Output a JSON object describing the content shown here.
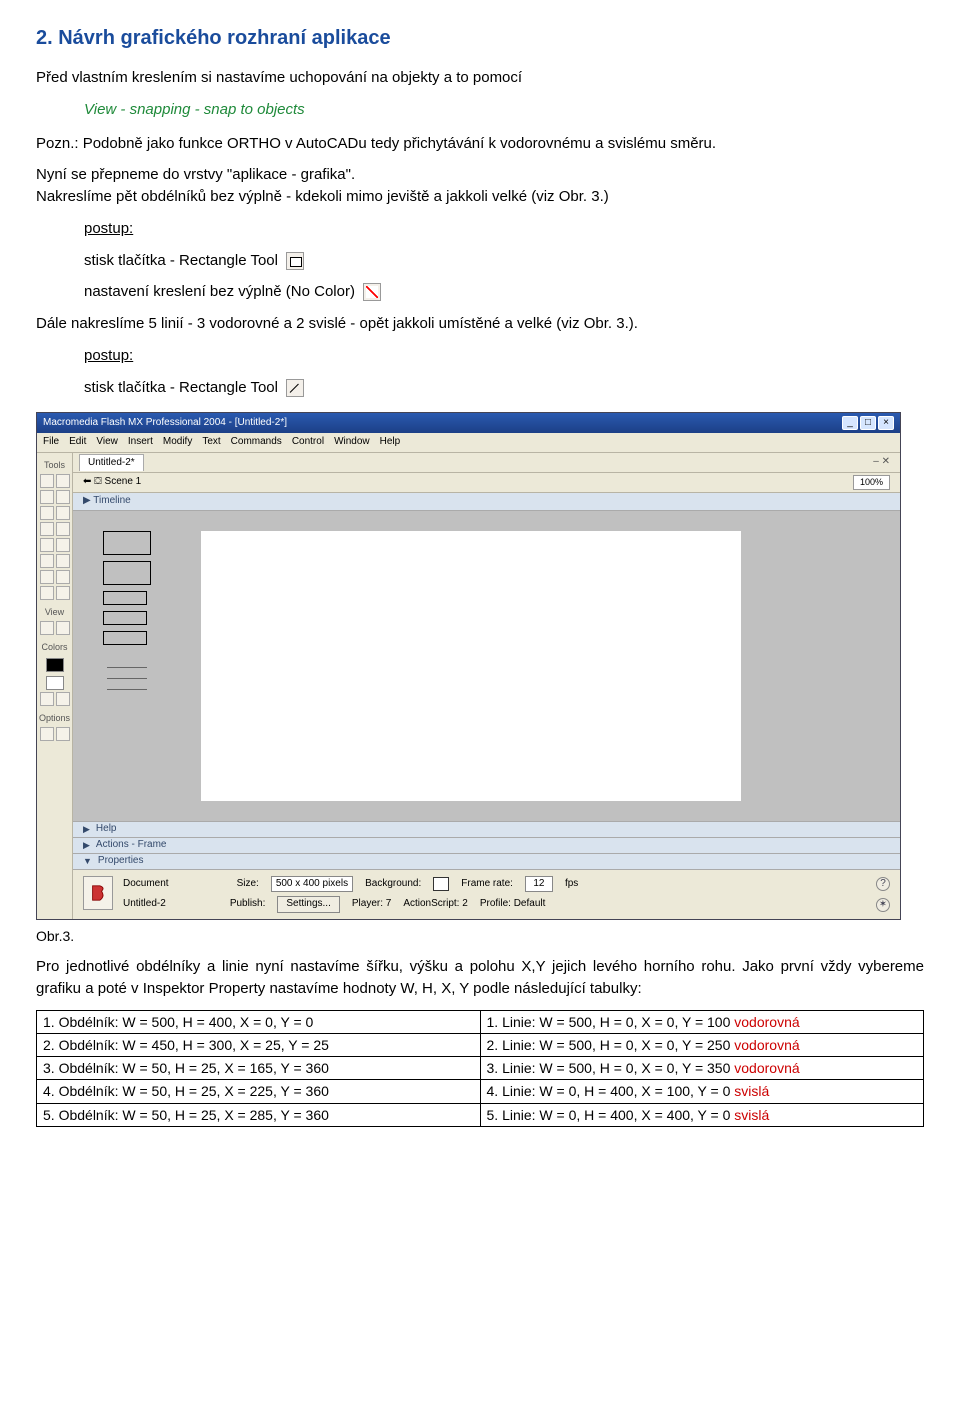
{
  "heading": "2. Návrh grafického rozhraní aplikace",
  "p1": "Před vlastním kreslením si nastavíme uchopování na objekty a to pomocí",
  "menupath": "View - snapping - snap to objects",
  "p2": "Pozn.: Podobně jako funkce ORTHO v AutoCADu tedy přichytávání k vodorovnému a svislému směru.",
  "p3a": "Nyní se přepneme do vrstvy \"aplikace - grafika\".",
  "p3b": "Nakreslíme pět obdélníků bez výplně - kdekoli  mimo jeviště a jakkoli velké (viz Obr. 3.)",
  "postup": "postup:",
  "step1a": "stisk tlačítka - Rectangle Tool",
  "step1b": "nastavení kreslení bez výplně (No Color)",
  "p4": "Dále nakreslíme 5 linií - 3 vodorovné a 2 svislé - opět jakkoli umístěné a velké (viz Obr. 3.).",
  "step2a": "stisk tlačítka - Rectangle Tool",
  "flash": {
    "title": "Macromedia Flash MX Professional 2004 - [Untitled-2*]",
    "menus": [
      "File",
      "Edit",
      "View",
      "Insert",
      "Modify",
      "Text",
      "Commands",
      "Control",
      "Window",
      "Help"
    ],
    "tools_lbl": "Tools",
    "view_lbl": "View",
    "colors_lbl": "Colors",
    "options_lbl": "Options",
    "doc_tab": "Untitled-2*",
    "tab_close": "– ✕",
    "scene": "Scene 1",
    "zoom": "100%",
    "timeline": "Timeline",
    "help": "Help",
    "actions": "Actions - Frame",
    "properties": "Properties",
    "props": {
      "doc_lbl": "Document",
      "doc_name": "Untitled-2",
      "size_lbl": "Size:",
      "size_val": "500 x 400 pixels",
      "publish_lbl": "Publish:",
      "publish_btn": "Settings...",
      "bg_lbl": "Background:",
      "player_lbl": "Player: 7",
      "as_lbl": "ActionScript: 2",
      "profile_lbl": "Profile: Default",
      "fr_lbl": "Frame rate:",
      "fr_val": "12",
      "fps": "fps"
    }
  },
  "caption": "Obr.3.",
  "p5": "Pro jednotlivé obdélníky a linie nyní nastavíme šířku, výšku a polohu X,Y jejich levého horního rohu. Jako první vždy vybereme grafiku a poté v Inspektor Property nastavíme hodnoty W, H, X, Y podle následující tabulky:",
  "table": {
    "rows": [
      {
        "l": "1. Obdélník: W = 500, H = 400, X  = 0, Y = 0",
        "r": "1. Linie: W = 500, H = 0, X = 0, Y = 100 ",
        "rtag": "vodorovná"
      },
      {
        "l": "2. Obdélník: W = 450, H = 300, X  = 25, Y = 25",
        "r": "2. Linie: W = 500, H = 0, X = 0, Y = 250 ",
        "rtag": "vodorovná"
      },
      {
        "l": "3. Obdélník: W = 50, H = 25, X  = 165, Y = 360",
        "r": "3. Linie: W = 500, H = 0, X = 0, Y = 350 ",
        "rtag": "vodorovná"
      },
      {
        "l": "4. Obdélník: W = 50, H = 25, X  = 225, Y = 360",
        "r": "4. Linie: W = 0, H = 400, X = 100, Y = 0 ",
        "rtag": "svislá"
      },
      {
        "l": "5. Obdélník: W = 50, H = 25, X  = 285, Y = 360",
        "r": "5. Linie: W = 0, H = 400, X = 400, Y = 0 ",
        "rtag": "svislá"
      }
    ]
  }
}
